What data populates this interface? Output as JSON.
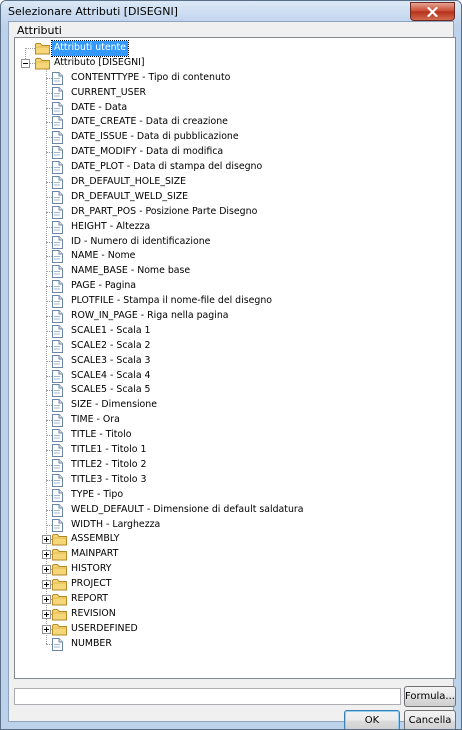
{
  "window": {
    "title": "Selezionare Attributi [DISEGNI]"
  },
  "group_label": "Attributi",
  "tree": {
    "user_node": "Attributi utente",
    "drawing_node": "Attributo [DISEGNI]",
    "attributes": [
      "CONTENTTYPE  -  Tipo di contenuto",
      "CURRENT_USER",
      "DATE  -  Data",
      "DATE_CREATE  -  Data di creazione",
      "DATE_ISSUE  -  Data di pubblicazione",
      "DATE_MODIFY  -  Data di modifica",
      "DATE_PLOT  -  Data di stampa del disegno",
      "DR_DEFAULT_HOLE_SIZE",
      "DR_DEFAULT_WELD_SIZE",
      "DR_PART_POS  -  Posizione Parte Disegno",
      "HEIGHT  -  Altezza",
      "ID  -  Numero di identificazione",
      "NAME  -  Nome",
      "NAME_BASE  -  Nome base",
      "PAGE  -  Pagina",
      "PLOTFILE  -  Stampa il nome-file del disegno",
      "ROW_IN_PAGE  -  Riga nella pagina",
      "SCALE1  -  Scala 1",
      "SCALE2  -  Scala 2",
      "SCALE3  -  Scala 3",
      "SCALE4  -  Scala 4",
      "SCALE5  -  Scala 5",
      "SIZE  -  Dimensione",
      "TIME  -  Ora",
      "TITLE  -  Titolo",
      "TITLE1  -  Titolo 1",
      "TITLE2  -  Titolo 2",
      "TITLE3  -  Titolo 3",
      "TYPE  -  Tipo",
      "WELD_DEFAULT  -  Dimensione di default saldatura",
      "WIDTH  -  Larghezza"
    ],
    "folders": [
      "ASSEMBLY",
      "MAINPART",
      "HISTORY",
      "PROJECT",
      "REPORT",
      "REVISION",
      "USERDEFINED"
    ],
    "last_item": "NUMBER"
  },
  "formula": {
    "value": "",
    "button_label": "Formula..."
  },
  "buttons": {
    "ok": "OK",
    "cancel": "Cancella"
  },
  "icons": {
    "folder": "folder-icon",
    "document": "document-icon",
    "close": "close-icon"
  }
}
